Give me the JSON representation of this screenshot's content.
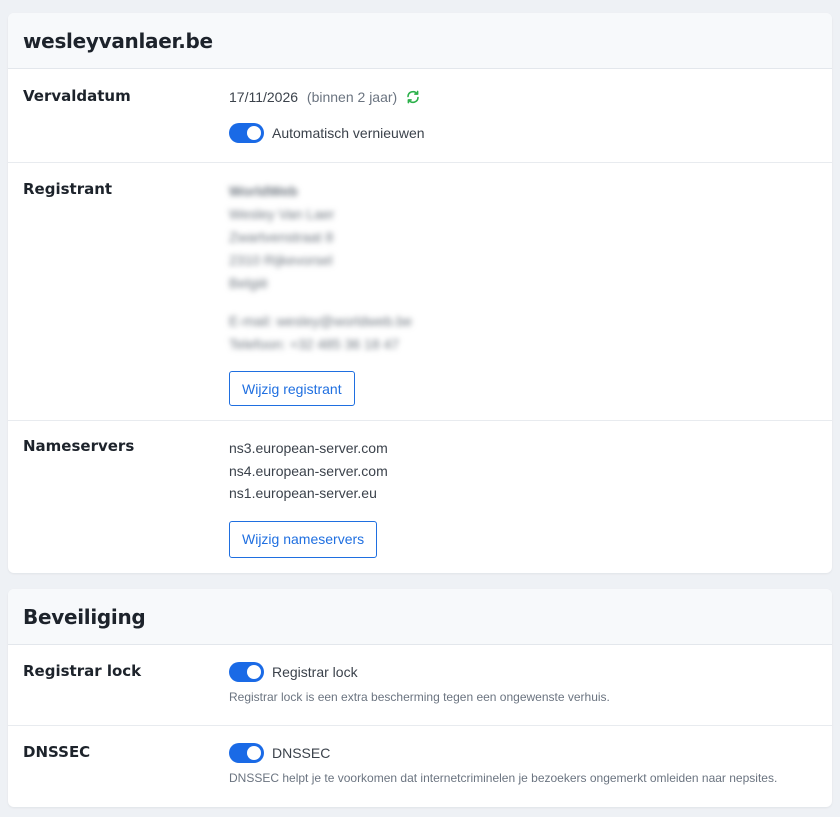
{
  "domain": {
    "title": "wesleyvanlaer.be",
    "expiry": {
      "label": "Vervaldatum",
      "date": "17/11/2026",
      "relative": "(binnen 2 jaar)",
      "auto_renew_label": "Automatisch vernieuwen",
      "auto_renew": true
    },
    "registrant": {
      "label": "Registrant",
      "company": "WorldWeb",
      "name": "Wesley Van Laer",
      "street": "Zwartvenstraat 8",
      "city": "2310 Rijkevorsel",
      "country": "België",
      "email": "E-mail: wesley@worldweb.be",
      "phone": "Telefoon: +32 485 36 18 47",
      "button": "Wijzig registrant"
    },
    "nameservers": {
      "label": "Nameservers",
      "items": [
        "ns3.european-server.com",
        "ns4.european-server.com",
        "ns1.european-server.eu"
      ],
      "button": "Wijzig nameservers"
    }
  },
  "security": {
    "title": "Beveiliging",
    "registrar_lock": {
      "label": "Registrar lock",
      "toggle_label": "Registrar lock",
      "enabled": true,
      "help": "Registrar lock is een extra bescherming tegen een ongewenste verhuis."
    },
    "dnssec": {
      "label": "DNSSEC",
      "toggle_label": "DNSSEC",
      "enabled": true,
      "help": "DNSSEC helpt je te voorkomen dat internetcriminelen je bezoekers ongemerkt omleiden naar nepsites."
    }
  },
  "colors": {
    "accent": "#1a6ae6",
    "renew_icon": "#2bb04a"
  }
}
